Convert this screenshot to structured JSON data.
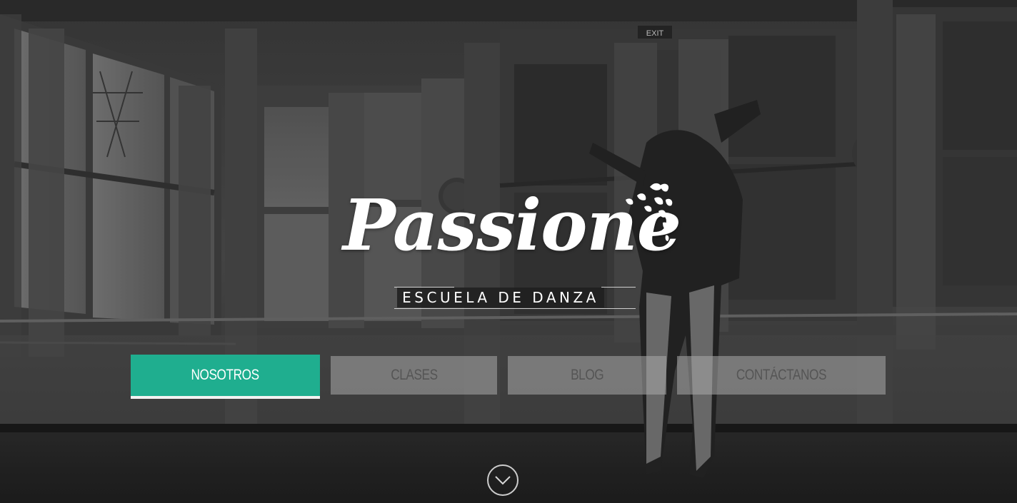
{
  "brand": {
    "name": "Passione",
    "tagline": "ESCUELA DE DANZA"
  },
  "nav": {
    "items": [
      {
        "label": "NOSOTROS",
        "active": true
      },
      {
        "label": "CLASES",
        "active": false
      },
      {
        "label": "BLOG",
        "active": false
      },
      {
        "label": "CONTÁCTANOS",
        "active": false
      }
    ]
  },
  "background": {
    "sign_text": "EXIT"
  },
  "colors": {
    "accent": "#1fae8f",
    "nav_inactive_bg": "rgba(170,170,170,0.55)",
    "nav_inactive_text": "#555555",
    "text_light": "#ffffff"
  },
  "icons": {
    "scroll": "chevron-down-icon",
    "logo_mark": "butterflies-icon"
  }
}
